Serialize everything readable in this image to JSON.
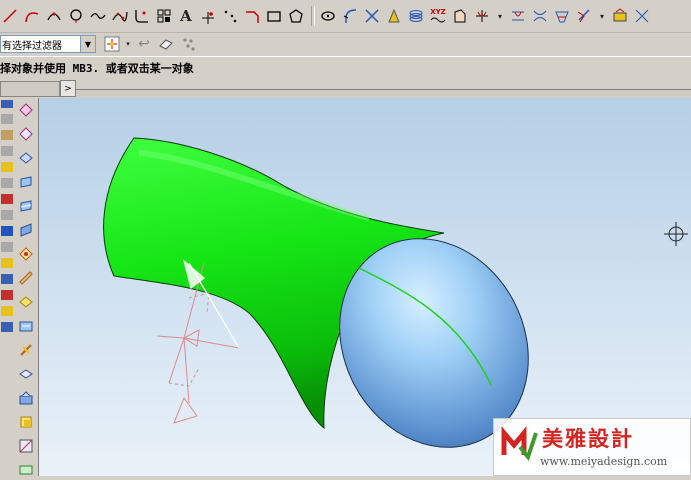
{
  "toolbar_top": {
    "icons": [
      "line-icon",
      "arc-icon",
      "arc-3pt-icon",
      "circle-icon",
      "curve-icon",
      "spline-icon",
      "fillet-icon",
      "offset-icon",
      "text-icon",
      "point-icon",
      "point-set-icon",
      "chamfer-icon",
      "rectangle-icon",
      "polygon-icon",
      "ellipse-icon",
      "sketch-icon",
      "trim-icon",
      "conic-icon",
      "helix-icon",
      "law-curve-icon",
      "bridge-icon",
      "extract-icon",
      "combine-icon",
      "project-icon",
      "intersect-icon",
      "section-icon",
      "wrap-icon",
      "offset-curve-icon"
    ],
    "text_glyph": "A",
    "xyz_label": "XYZ"
  },
  "filter": {
    "selected": "有选择过滤器"
  },
  "toolbar_second": {
    "icons": [
      "selection-icon",
      "undo-arrow-icon",
      "cube-icon",
      "snap-icon"
    ]
  },
  "status": {
    "prompt": "择对象并使用 MB3. 或者双击某一对象"
  },
  "nav": {
    "arrow": ">"
  },
  "left_tools": {
    "icons": [
      "sketch-plane-icon",
      "surface-icon",
      "face-icon",
      "extrude-icon",
      "revolve-icon",
      "sweep-icon",
      "blend-icon",
      "chamfer-tool-icon",
      "shell-icon",
      "hole-icon",
      "boss-icon",
      "pad-icon",
      "edit-icon",
      "trim-body-icon",
      "thicken-icon",
      "sew-icon",
      "pattern-icon",
      "mirror-icon"
    ]
  },
  "model": {
    "body_color": "#16ea16",
    "cap_color": "#8bc7f2",
    "edge_color": "#0e7d0e",
    "csys_color": "#e08a8a"
  },
  "watermark": {
    "title": "美雅設計",
    "url": "www.meiyadesign.com",
    "logo_letter": "M",
    "brand_color": "#d32420"
  }
}
